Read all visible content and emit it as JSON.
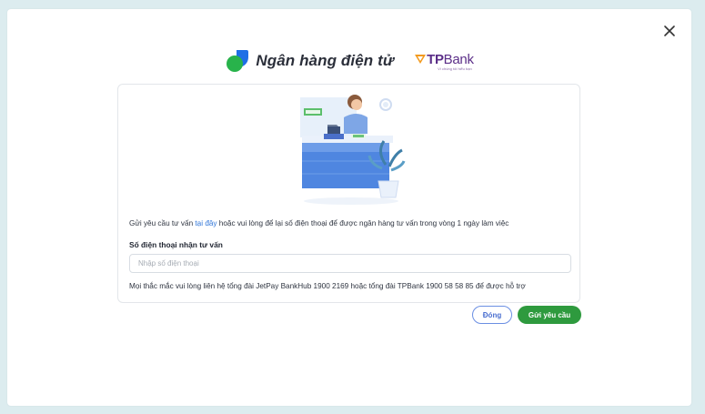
{
  "modal": {
    "close_icon": "close-icon"
  },
  "header": {
    "brand_title": "Ngân hàng điện tử",
    "brand_icon": "jetpay-leaf-icon",
    "partner": {
      "name_tp": "TP",
      "name_bank": "Bank",
      "tagline": "Vì chúng tôi hiểu bạn"
    }
  },
  "form": {
    "intro_prefix": "Gửi yêu cầu tư vấn ",
    "intro_link": "tại đây",
    "intro_suffix": " hoặc vui lòng để lại số điện thoại để được ngân hàng tư vấn trong vòng 1 ngày làm việc",
    "phone_label": "Số điện thoại nhận tư vấn",
    "phone_placeholder": "Nhập số điện thoại",
    "phone_value": "",
    "support_text": "Mọi thắc mắc vui lòng liên hệ tổng đài JetPay BankHub 1900 2169 hoặc tổng đài TPBank 1900 58 58 85 để được hỗ trợ"
  },
  "actions": {
    "close_label": "Đóng",
    "submit_label": "Gửi yêu cầu"
  },
  "colors": {
    "accent_blue": "#2e74d8",
    "submit_green": "#2e9a3e",
    "tpbank_purple": "#5b2e88",
    "tpbank_orange": "#f39a1e"
  }
}
